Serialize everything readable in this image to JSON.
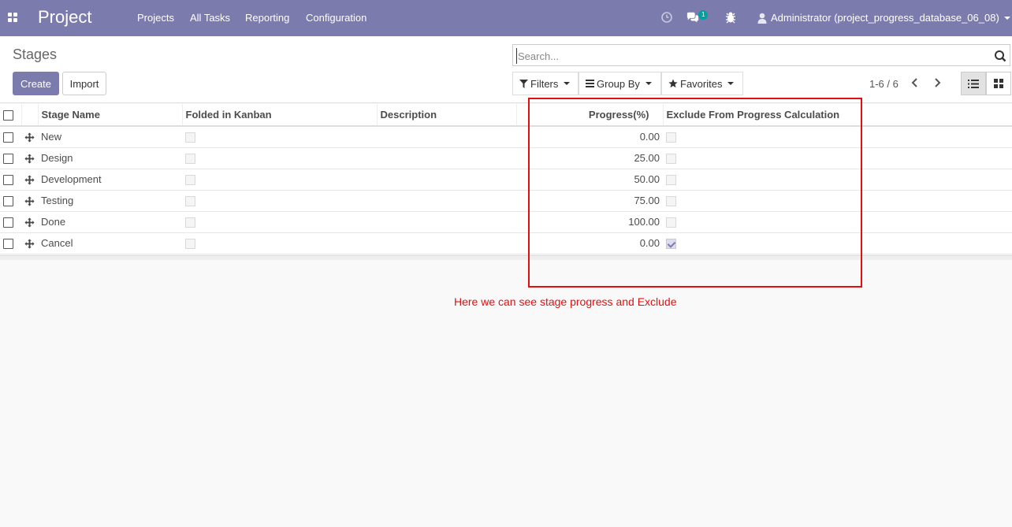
{
  "navbar": {
    "brand": "Project",
    "menu": [
      "Projects",
      "All Tasks",
      "Reporting",
      "Configuration"
    ],
    "chat_badge": "1",
    "user": "Administrator (project_progress_database_06_08)",
    "icons": [
      "apps-icon",
      "clock-icon",
      "chat-icon",
      "bug-icon",
      "user-icon"
    ],
    "color": "#7c7bad"
  },
  "control_panel": {
    "title": "Stages",
    "create_label": "Create",
    "import_label": "Import",
    "search_placeholder": "Search...",
    "filters_label": "Filters",
    "group_by_label": "Group By",
    "favorites_label": "Favorites",
    "pager": "1-6 / 6"
  },
  "table": {
    "headers": [
      "Stage Name",
      "Folded in Kanban",
      "Description",
      "Progress(%)",
      "Exclude From Progress Calculation"
    ],
    "rows": [
      {
        "name": "New",
        "folded": false,
        "description": "",
        "progress": "0.00",
        "exclude": false
      },
      {
        "name": "Design",
        "folded": false,
        "description": "",
        "progress": "25.00",
        "exclude": false
      },
      {
        "name": "Development",
        "folded": false,
        "description": "",
        "progress": "50.00",
        "exclude": false
      },
      {
        "name": "Testing",
        "folded": false,
        "description": "",
        "progress": "75.00",
        "exclude": false
      },
      {
        "name": "Done",
        "folded": false,
        "description": "",
        "progress": "100.00",
        "exclude": false
      },
      {
        "name": "Cancel",
        "folded": false,
        "description": "",
        "progress": "0.00",
        "exclude": true
      }
    ]
  },
  "annotation": {
    "text": "Here we can see stage progress and Exclude",
    "color": "#e01010"
  }
}
